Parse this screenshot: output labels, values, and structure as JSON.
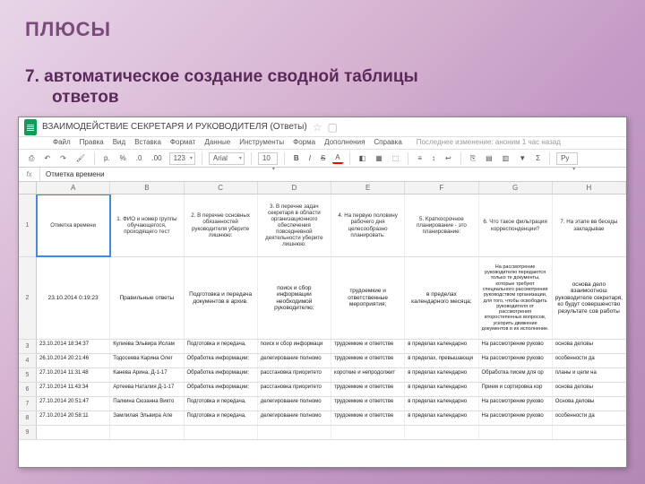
{
  "slide": {
    "title": "ПЛЮСЫ",
    "subtitle_num": "7.",
    "subtitle_line1": "автоматическое создание сводной таблицы",
    "subtitle_line2": "ответов"
  },
  "doc": {
    "title": "ВЗАИМОДЕЙСТВИЕ СЕКРЕТАРЯ И РУКОВОДИТЕЛЯ (Ответы)",
    "star": "☆",
    "folder": "▢"
  },
  "menu": {
    "file": "Файл",
    "edit": "Правка",
    "view": "Вид",
    "insert": "Вставка",
    "format": "Формат",
    "data": "Данные",
    "tools": "Инструменты",
    "form": "Форма",
    "addons": "Дополнения",
    "help": "Справка",
    "last_change": "Последнее изменение: аноним 1 час назад"
  },
  "toolbar": {
    "print": "⎙",
    "undo": "↶",
    "redo": "↷",
    "paint": "🖌",
    "currency": "р.",
    "percent": "%",
    "dec0": ".0",
    "dec00": ".00",
    "numfmt": "123",
    "font": "Arial",
    "size": "10",
    "bold": "B",
    "italic": "I",
    "strike": "S",
    "color": "A",
    "fill": "◧",
    "border": "▦",
    "merge": "⬚",
    "halign": "≡",
    "valign": "↕",
    "wrap": "↩",
    "link": "⎘",
    "comment": "▤",
    "chart": "▥",
    "filter": "▼",
    "sigma": "Σ",
    "lang": "Ру"
  },
  "fx": {
    "label": "fx",
    "value": "Отметка времени"
  },
  "cols": [
    "A",
    "B",
    "C",
    "D",
    "E",
    "F",
    "G",
    "H"
  ],
  "header_row": {
    "num": "1",
    "A": "Отметка времени",
    "B": "1. ФИО и номер группы обучающегося, проходящего тест",
    "C": "2. В перечне основных обязанностей руководителя уберите лишнюю:",
    "D": "3. В перечне задач секретаря в области организационного обеспечения повседневной деятельности уберите лишнюю:",
    "E": "4. На первую половину рабочего дня целесообразно планировать:",
    "F": "5. Краткосрочное планирование - это планирование:",
    "G": "6. Что такое фильтрация корреспонденции?",
    "H": "7. На этапе вв беседы закладывае"
  },
  "row2": {
    "num": "2",
    "A": "23.10.2014 0:19:23",
    "B": "Правильные ответы",
    "C": "Подготовка и передача документов в архив.",
    "D": "поиск и сбор информации необходимой руководителю;",
    "E": "трудоемкие и ответственные мероприятия;",
    "F": "в пределах календарного месяца;",
    "G": "На рассмотрение руководителю передаются только те документы, которые требуют специального рассмотрения руководством организации, для того, чтобы освободить руководителя от рассмотрения второстепенных вопросов, ускорить движение документов и их исполнение.",
    "H": "основа дело взаимоотнош руководителе секретаря, ко будут совершенство результате сов работы"
  },
  "small_rows": [
    {
      "num": "3",
      "A": "23.10.2014 18:34:37",
      "B": "Кулиева Эльвира Ислам",
      "C": "Подготовка и передача,",
      "D": "поиск и сбор информаци",
      "E": "трудоемкие и ответстве",
      "F": "в пределах календарно",
      "G": "На рассмотрение руково",
      "H": "основа деловы"
    },
    {
      "num": "4",
      "A": "26.10.2014 20:21:46",
      "B": "Тодосеева Карина Олег",
      "C": "Обработка информации;",
      "D": "делегирование полномо",
      "E": "трудоемкие и ответстве",
      "F": "в пределах, превышающи",
      "G": "На рассмотрение руково",
      "H": "особенности да"
    },
    {
      "num": "5",
      "A": "27.10.2014 11:31:48",
      "B": "Канева Арина, Д-1-17",
      "C": "Обработка информации;",
      "D": "расстановка приоритето",
      "E": "короткие и непродолжит",
      "F": "в пределах календарно",
      "G": "Обработка писем для ор",
      "H": "планы и цели на"
    },
    {
      "num": "6",
      "A": "27.10.2014 11:43:34",
      "B": "Артеева Наталия Д-1-17",
      "C": "Обработка информации;",
      "D": "расстановка приоритето",
      "E": "трудоемкие и ответстве",
      "F": "в пределах календарно",
      "G": "Прием и сортировка кор",
      "H": "основа деловы"
    },
    {
      "num": "7",
      "A": "27.10.2014 20:51:47",
      "B": "Палкина Сюзанна Викто",
      "C": "Подготовка и передача,",
      "D": "делегирование полномо",
      "E": "трудоемкие и ответстве",
      "F": "в пределах календарно",
      "G": "На рассмотрение руково",
      "H": "Основа деловы"
    },
    {
      "num": "8",
      "A": "27.10.2014 20:58:11",
      "B": "Замлилая Эльвира Але",
      "C": "Подготовка и передача,",
      "D": "делегирование полномо",
      "E": "трудоемкие и ответстве",
      "F": "в пределах календарно",
      "G": "На рассмотрение руково",
      "H": "особенности да"
    },
    {
      "num": "9",
      "A": "",
      "B": "",
      "C": "",
      "D": "",
      "E": "",
      "F": "",
      "G": "",
      "H": ""
    }
  ]
}
